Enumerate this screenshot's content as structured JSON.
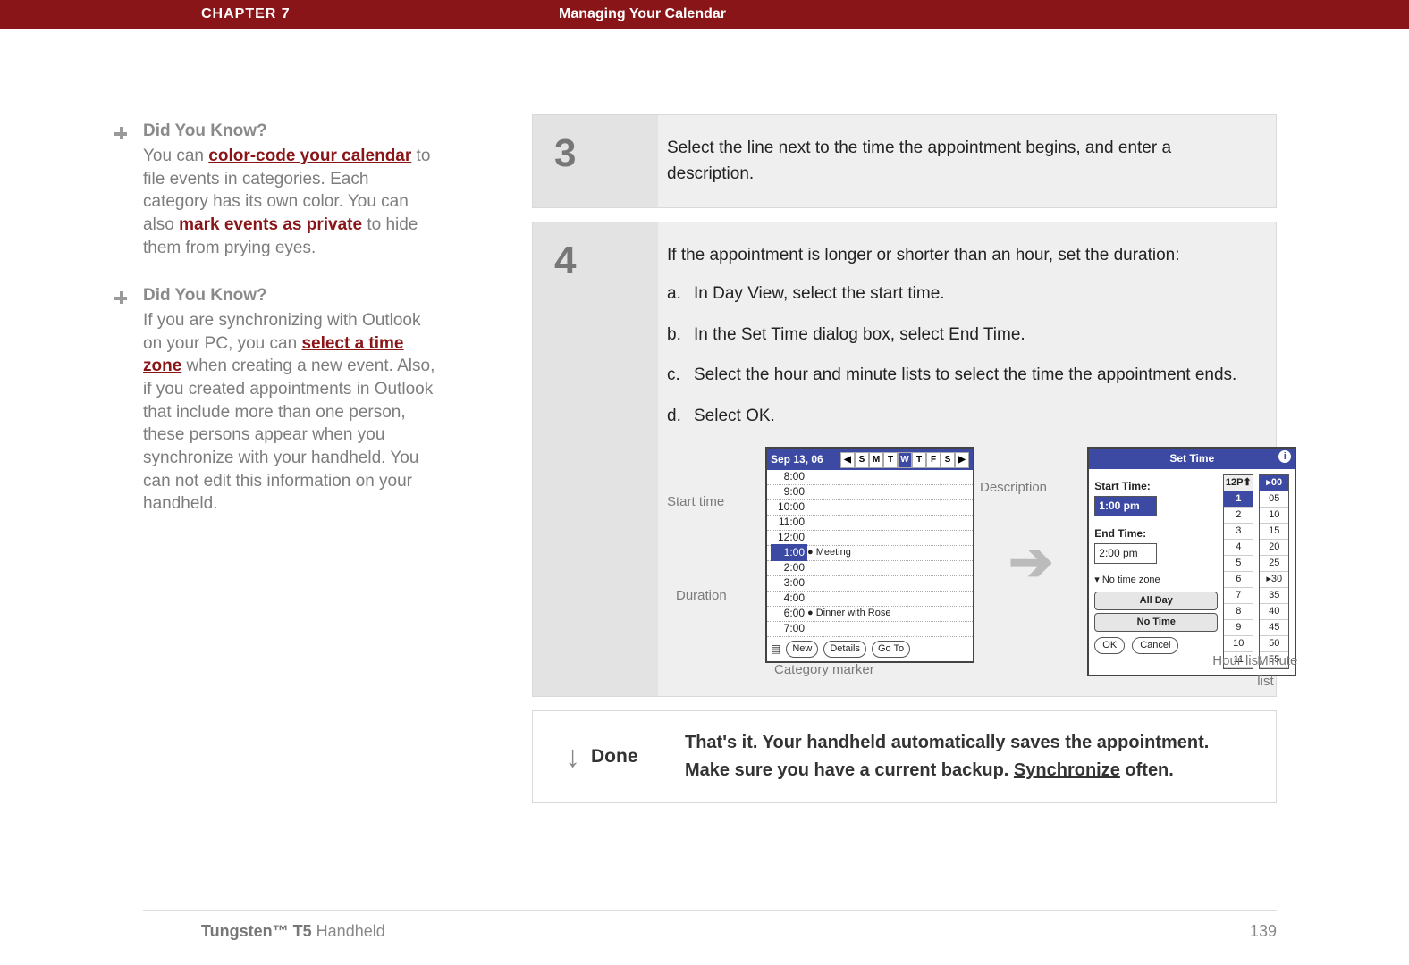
{
  "header": {
    "chapter": "CHAPTER 7",
    "title": "Managing Your Calendar"
  },
  "tips": [
    {
      "heading": "Did You Know?",
      "text_pre": "You can ",
      "link1": "color-code your calendar",
      "text_mid": " to file events in categories. Each category has its own color. You can also ",
      "link2": "mark events as private",
      "text_post": " to hide them from prying eyes."
    },
    {
      "heading": "Did You Know?",
      "text_pre": "If you are synchronizing with Outlook on your PC, you can ",
      "link1": "select a time zone",
      "text_mid": " when creating a new event. Also, if you created appointments in Outlook that include more than one person, these persons appear when you synchronize with your handheld. You can not edit this information on your handheld.",
      "link2": "",
      "text_post": ""
    }
  ],
  "steps": {
    "s3": {
      "num": "3",
      "text": "Select the line next to the time the appointment begins, and enter a description."
    },
    "s4": {
      "num": "4",
      "intro": "If the appointment is longer or shorter than an hour, set the duration:",
      "a": "In Day View, select the start time.",
      "b": "In the Set Time dialog box, select End Time.",
      "c": "Select the hour and minute lists to select the time the appointment ends.",
      "d": "Select OK."
    }
  },
  "callouts": {
    "start_time": "Start time",
    "duration": "Duration",
    "description": "Description",
    "category": "Category marker",
    "hour_list": "Hour list",
    "minute_list": "Minute list"
  },
  "palm1": {
    "date": "Sep 13, 06",
    "days": [
      "S",
      "M",
      "T",
      "W",
      "T",
      "F",
      "S"
    ],
    "sel_day_index": 3,
    "slots": [
      "8:00",
      "9:00",
      "10:00",
      "11:00",
      "12:00",
      "1:00",
      "2:00",
      "3:00",
      "4:00",
      "6:00",
      "7:00"
    ],
    "sel_slot_index": 5,
    "events": {
      "5": "Meeting",
      "9": "Dinner with Rose"
    },
    "toolbar": [
      "New",
      "Details",
      "Go To"
    ]
  },
  "palm2": {
    "title": "Set Time",
    "start_label": "Start Time:",
    "start_value": "1:00 pm",
    "end_label": "End Time:",
    "end_value": "2:00 pm",
    "tz": "No time zone",
    "allday": "All Day",
    "notime": "No Time",
    "ok": "OK",
    "cancel": "Cancel",
    "hours_hdr": "12P",
    "hours": [
      "1",
      "2",
      "3",
      "4",
      "5",
      "6",
      "7",
      "8",
      "9",
      "10",
      "11"
    ],
    "hours_sel": 0,
    "minutes": [
      "00",
      "05",
      "10",
      "15",
      "20",
      "25",
      "30",
      "35",
      "40",
      "45",
      "50",
      "55"
    ],
    "minutes_sel": 0
  },
  "done": {
    "label": "Done",
    "text_a": "That's it. Your handheld automatically saves the appointment. Make sure you have a current backup. ",
    "link": "Synchronize",
    "text_b": " often."
  },
  "footer": {
    "product_b": "Tungsten™ T5",
    "product_rest": " Handheld",
    "page": "139"
  }
}
